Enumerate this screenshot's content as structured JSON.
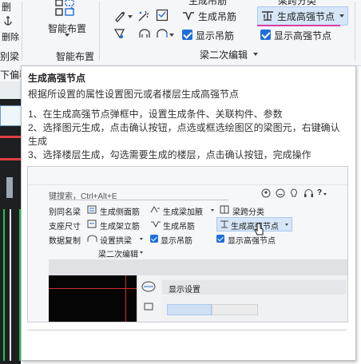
{
  "ribbon": {
    "left_clip_labels": [
      "删",
      "锁",
      "删除",
      "别梁"
    ],
    "smart_layout_label": "智能布置",
    "group_smart_layout": "智能布置",
    "top_clip_row": [
      "生成吊筋",
      "梁跨分类"
    ],
    "gen_hanger_label": "生成吊筋",
    "gen_strong_node_label": "生成高强节点",
    "show_hanger_label": "显示吊筋",
    "show_strong_node_label": "显示高强节点",
    "group_beam_edit": "梁二次编辑",
    "left_partial": "下偏移"
  },
  "tooltip": {
    "title": "生成高强节点",
    "description": "根据所设置的属性设置图元或者楼层生成高强节点",
    "steps": [
      "1、在生成高强节点弹框中，设置生成条件、关联构件、参数",
      "2、选择图元生成，点击确认按钮，点选或框选绘图区的梁图元，右键确认生成",
      "3、选择楼层生成，勾选需要生成的楼层，点击确认按钮，完成操作"
    ]
  },
  "preview": {
    "search_placeholder": "键搜索，Ctrl+Alt+E",
    "row1": [
      "别同名梁",
      "生成侧面筋",
      "生成梁加腋",
      "梁跨分类"
    ],
    "row2": [
      "支座尺寸",
      "生成架立筋",
      "生成吊筋",
      "生成高强节点"
    ],
    "row3": [
      "数据复制",
      "设置拱梁",
      "显示吊筋",
      "显示高强节点"
    ],
    "group_label": "梁二次编辑",
    "panel_title": "显示设置",
    "help": "?"
  },
  "colors": {
    "accent": "#1e6fd9",
    "highlight_underline": "#d63fa4",
    "selected_bg": "#d6e6f8"
  }
}
